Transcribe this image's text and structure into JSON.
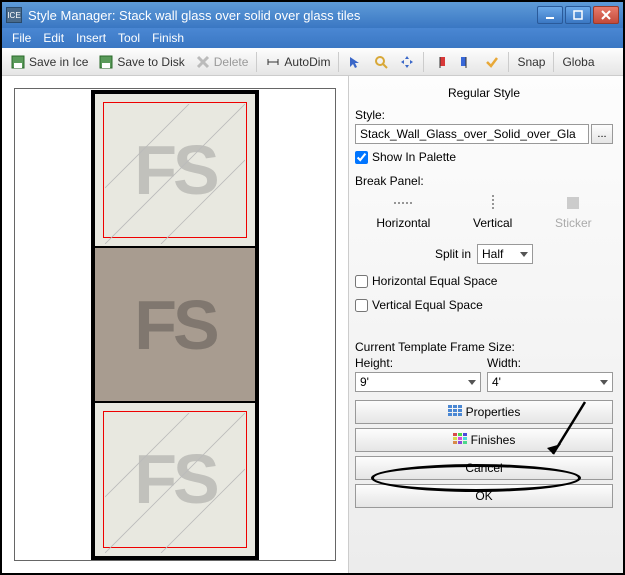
{
  "window": {
    "title": "Style Manager: Stack wall glass over solid  over glass tiles",
    "app_icon_text": "ICE"
  },
  "menu": {
    "file": "File",
    "edit": "Edit",
    "insert": "Insert",
    "tool": "Tool",
    "finish": "Finish"
  },
  "toolbar": {
    "save_ice": "Save in Ice",
    "save_disk": "Save to Disk",
    "delete": "Delete",
    "autodim": "AutoDim",
    "snap": "Snap",
    "global": "Globa"
  },
  "panel": {
    "heading": "Regular Style",
    "style_label": "Style:",
    "style_value": "Stack_Wall_Glass_over_Solid_over_Gla",
    "ellipsis": "...",
    "show_in_palette": "Show In Palette",
    "break_panel_label": "Break Panel:",
    "break": {
      "horizontal": "Horizontal",
      "vertical": "Vertical",
      "sticker": "Sticker"
    },
    "split_in_label": "Split in",
    "split_value": "Half",
    "h_equal": "Horizontal Equal Space",
    "v_equal": "Vertical Equal Space",
    "frame_size_label": "Current Template Frame Size:",
    "height_label": "Height:",
    "width_label": "Width:",
    "height_value": "9'",
    "width_value": "4'",
    "properties_btn": "Properties",
    "finishes_btn": "Finishes",
    "cancel_btn": "Cancel",
    "ok_btn": "OK"
  },
  "preview": {
    "fs": "FS"
  }
}
